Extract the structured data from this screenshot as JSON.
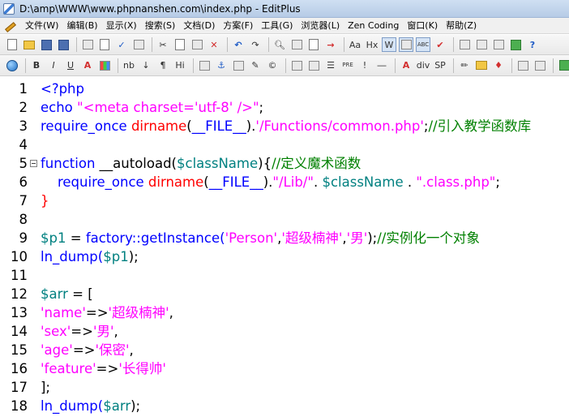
{
  "window": {
    "title": "D:\\amp\\WWW\\www.phpnanshen.com\\index.php - EditPlus"
  },
  "menu": [
    {
      "label": "文件(W)"
    },
    {
      "label": "编辑(B)"
    },
    {
      "label": "显示(X)"
    },
    {
      "label": "搜索(S)"
    },
    {
      "label": "文档(D)"
    },
    {
      "label": "方案(F)"
    },
    {
      "label": "工具(G)"
    },
    {
      "label": "浏览器(L)"
    },
    {
      "label": "Zen Coding"
    },
    {
      "label": "窗口(K)"
    },
    {
      "label": "帮助(Z)"
    }
  ],
  "toolbar2_labels": {
    "bold": "B",
    "italic": "I",
    "underline": "U",
    "font": "A",
    "nb": "nb",
    "arrow": "↓",
    "para": "¶",
    "hi": "Hi",
    "pre": "PRE",
    "div": "div",
    "sp": "SP",
    "aa": "Aa",
    "hx": "Hx",
    "w": "W",
    "abc": "ABC"
  },
  "colors": {
    "keyword": "#0000ff",
    "string": "#ff00ff",
    "function": "#ff0000",
    "variable": "#008080",
    "comment": "#008000"
  },
  "editor": {
    "lines": [
      {
        "n": "1",
        "tokens": [
          {
            "c": "k",
            "t": "<?php"
          }
        ]
      },
      {
        "n": "2",
        "tokens": [
          {
            "c": "k",
            "t": "echo"
          },
          {
            "c": "p",
            "t": " "
          },
          {
            "c": "s",
            "t": "\"<meta charset='utf-8' />\""
          },
          {
            "c": "p",
            "t": ";"
          }
        ]
      },
      {
        "n": "3",
        "tokens": [
          {
            "c": "k",
            "t": "require_once"
          },
          {
            "c": "p",
            "t": " "
          },
          {
            "c": "f",
            "t": "dirname"
          },
          {
            "c": "p",
            "t": "("
          },
          {
            "c": "k",
            "t": "__FILE__"
          },
          {
            "c": "p",
            "t": ")."
          },
          {
            "c": "s",
            "t": "'/Functions/common.php'"
          },
          {
            "c": "p",
            "t": ";"
          },
          {
            "c": "c",
            "t": "//引入教学函数库"
          }
        ]
      },
      {
        "n": "4",
        "tokens": []
      },
      {
        "n": "5",
        "fold": true,
        "tokens": [
          {
            "c": "k",
            "t": "function"
          },
          {
            "c": "p",
            "t": " __autoload("
          },
          {
            "c": "v",
            "t": "$className"
          },
          {
            "c": "p",
            "t": "){"
          },
          {
            "c": "c",
            "t": "//定义魔术函数"
          }
        ]
      },
      {
        "n": "6",
        "tokens": [
          {
            "c": "p",
            "t": "    "
          },
          {
            "c": "k",
            "t": "require_once"
          },
          {
            "c": "p",
            "t": " "
          },
          {
            "c": "f",
            "t": "dirname"
          },
          {
            "c": "p",
            "t": "("
          },
          {
            "c": "k",
            "t": "__FILE__"
          },
          {
            "c": "p",
            "t": ")."
          },
          {
            "c": "s",
            "t": "\"/Lib/\""
          },
          {
            "c": "p",
            "t": ". "
          },
          {
            "c": "v",
            "t": "$className"
          },
          {
            "c": "p",
            "t": " . "
          },
          {
            "c": "s",
            "t": "\".class.php\""
          },
          {
            "c": "p",
            "t": ";"
          }
        ]
      },
      {
        "n": "7",
        "tokens": [
          {
            "c": "f",
            "t": "}"
          }
        ]
      },
      {
        "n": "8",
        "tokens": []
      },
      {
        "n": "9",
        "tokens": [
          {
            "c": "v",
            "t": "$p1"
          },
          {
            "c": "p",
            "t": " = "
          },
          {
            "c": "k",
            "t": "factory::getInstance("
          },
          {
            "c": "s",
            "t": "'Person'"
          },
          {
            "c": "p",
            "t": ","
          },
          {
            "c": "s",
            "t": "'超级楠神'"
          },
          {
            "c": "p",
            "t": ","
          },
          {
            "c": "s",
            "t": "'男'"
          },
          {
            "c": "p",
            "t": ");"
          },
          {
            "c": "c",
            "t": "//实例化一个对象"
          }
        ]
      },
      {
        "n": "10",
        "tokens": [
          {
            "c": "k",
            "t": "ln_dump("
          },
          {
            "c": "v",
            "t": "$p1"
          },
          {
            "c": "p",
            "t": ");"
          }
        ]
      },
      {
        "n": "11",
        "tokens": []
      },
      {
        "n": "12",
        "tokens": [
          {
            "c": "v",
            "t": "$arr"
          },
          {
            "c": "p",
            "t": " = ["
          }
        ]
      },
      {
        "n": "13",
        "tokens": [
          {
            "c": "s",
            "t": "'name'"
          },
          {
            "c": "p",
            "t": "=>"
          },
          {
            "c": "s",
            "t": "'超级楠神'"
          },
          {
            "c": "p",
            "t": ","
          }
        ]
      },
      {
        "n": "14",
        "tokens": [
          {
            "c": "s",
            "t": "'sex'"
          },
          {
            "c": "p",
            "t": "=>"
          },
          {
            "c": "s",
            "t": "'男'"
          },
          {
            "c": "p",
            "t": ","
          }
        ]
      },
      {
        "n": "15",
        "tokens": [
          {
            "c": "s",
            "t": "'age'"
          },
          {
            "c": "p",
            "t": "=>"
          },
          {
            "c": "s",
            "t": "'保密'"
          },
          {
            "c": "p",
            "t": ","
          }
        ]
      },
      {
        "n": "16",
        "tokens": [
          {
            "c": "s",
            "t": "'feature'"
          },
          {
            "c": "p",
            "t": "=>"
          },
          {
            "c": "s",
            "t": "'长得帅'"
          }
        ]
      },
      {
        "n": "17",
        "tokens": [
          {
            "c": "p",
            "t": "];"
          }
        ]
      },
      {
        "n": "18",
        "tokens": [
          {
            "c": "k",
            "t": "ln_dump("
          },
          {
            "c": "v",
            "t": "$arr"
          },
          {
            "c": "p",
            "t": ");"
          }
        ]
      }
    ]
  }
}
